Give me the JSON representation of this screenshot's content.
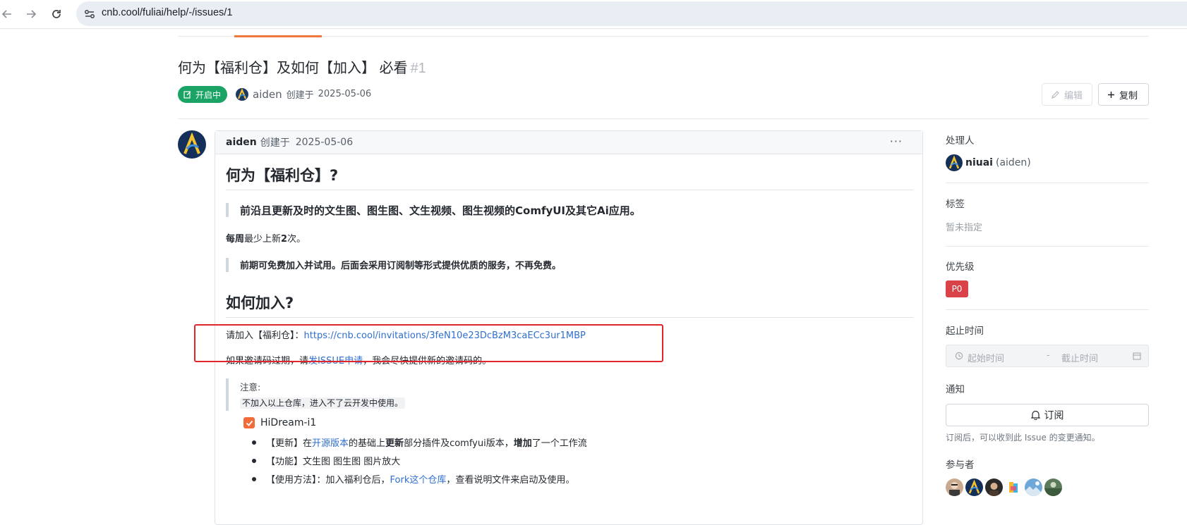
{
  "browser": {
    "url": "cnb.cool/fuliai/help/-/issues/1"
  },
  "issue": {
    "title": "何为【福利仓】及如何【加入】 必看",
    "number": "#1",
    "status": "开启中",
    "author": "aiden",
    "created_label": "创建于",
    "created_date": "2025-05-06",
    "edit_label": "编辑",
    "copy_label": "复制"
  },
  "comment": {
    "author": "aiden",
    "created_label": "创建于",
    "date": "2025-05-06",
    "more": "···",
    "h1_what": "何为【福利仓】?",
    "quote_1": "前沿且更新及时的文生图、图生图、文生视频、图生视频的ComfyUI及其它Ai应用。",
    "weekly_bold": "每周",
    "weekly_mid": "最少上新",
    "weekly_num": "2",
    "weekly_end": "次。",
    "quote_2": "前期可免费加入并试用。后面会采用订阅制等形式提供优质的服务，不再免费。",
    "h1_how": "如何加入?",
    "join_prefix": "请加入【福利仓】：",
    "join_link": "https://cnb.cool/invitations/3feN10e23DcBzM3caECc3ur1MBP",
    "expired_prefix": "如果邀请码过期，请",
    "expired_link": "发ISSUE申请",
    "expired_suffix": "，我会尽快提供新的邀请码的。",
    "note_title": "注意:",
    "note_code": "不加入以上仓库，进入不了云开发中使用。",
    "task_label": "HiDream-i1",
    "bullets": [
      {
        "pre": "【更新】在",
        "link": "开源版本",
        "mid": "的基础上",
        "bold": "更新",
        "mid2": "部分插件及comfyui版本，",
        "bold2": "增加",
        "end": "了一个工作流"
      },
      {
        "text": "【功能】文生图 图生图 图片放大"
      },
      {
        "pre": "【使用方法】：加入福利仓后，",
        "link": "Fork这个仓库",
        "end": "，查看说明文件来启动及使用。"
      }
    ]
  },
  "sidebar": {
    "assignee_label": "处理人",
    "assignee_name": "niuai",
    "assignee_sub": "(aiden)",
    "labels_label": "标签",
    "labels_empty": "暂未指定",
    "priority_label": "优先级",
    "priority_value": "P0",
    "daterange_label": "起止时间",
    "start_placeholder": "起始时间",
    "separator": "-",
    "end_placeholder": "截止时间",
    "notify_label": "通知",
    "subscribe_label": "订阅",
    "notify_note": "订阅后，可以收到此 Issue 的变更通知。",
    "participants_label": "参与者"
  },
  "colors": {
    "open_badge": "#1aa365",
    "priority_p0": "#d94249",
    "link": "#2f6fd0",
    "highlight": "#e0262b",
    "accent_tab": "#f0783c"
  }
}
